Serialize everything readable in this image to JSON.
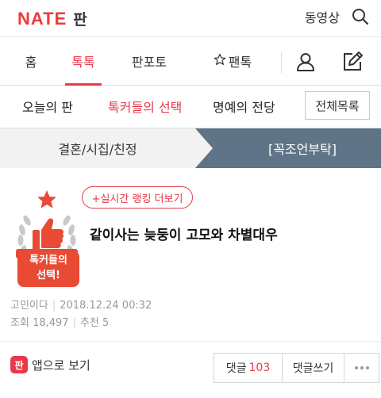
{
  "header": {
    "logo_text": "NATE",
    "logo_section": "판",
    "video_link": "동영상",
    "search_icon": "search-icon"
  },
  "tabs": {
    "items": [
      {
        "label": "홈"
      },
      {
        "label": "톡톡",
        "active": true
      },
      {
        "label": "판포토"
      },
      {
        "label": "팬톡",
        "icon": "star-icon"
      }
    ],
    "user_icon": "user-icon",
    "write_icon": "pencil-icon"
  },
  "subnav": {
    "items": [
      {
        "label": "오늘의 판"
      },
      {
        "label": "톡커들의 선택",
        "active": true
      },
      {
        "label": "명예의 전당"
      }
    ],
    "all_button": "전체목록"
  },
  "category": {
    "left": "결혼/시집/친정",
    "right": "[꼭조언부탁]"
  },
  "article": {
    "ranking_link": "+실시간 랭킹 더보기",
    "badge_text_line1": "톡커들의",
    "badge_text_line2": "선택!",
    "title": "같이사는 늦둥이 고모와 차별대우",
    "author": "고민이다",
    "date": "2018.12.24 00:32",
    "views_label": "조회",
    "views": "18,497",
    "likes_label": "추천",
    "likes": "5"
  },
  "bottom": {
    "app_icon_text": "판",
    "app_label": "앱으로 보기",
    "comments_label": "댓글",
    "comments_count": "103",
    "write_comment_label": "댓글쓰기",
    "more_icon": "more-icon"
  },
  "colors": {
    "accent": "#e8394a",
    "category_active": "#5f7486"
  }
}
